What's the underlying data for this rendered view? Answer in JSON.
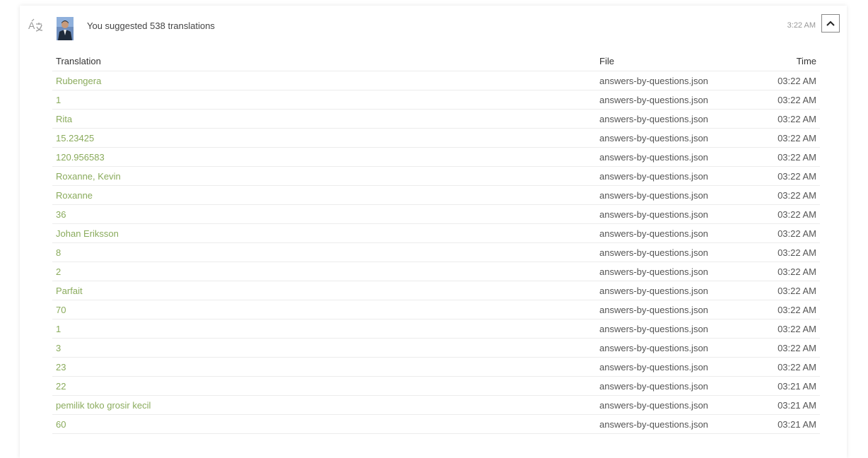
{
  "activity": {
    "icon": "translate-icon",
    "avatar": "user-avatar",
    "summary": "You suggested 538 translations",
    "timestamp": "3:22 AM",
    "collapse_icon": "chevron-up-icon"
  },
  "table": {
    "headers": {
      "translation": "Translation",
      "file": "File",
      "time": "Time"
    },
    "rows": [
      {
        "translation": "Rubengera",
        "file": "answers-by-questions.json",
        "time": "03:22 AM"
      },
      {
        "translation": "1",
        "file": "answers-by-questions.json",
        "time": "03:22 AM"
      },
      {
        "translation": "Rita",
        "file": "answers-by-questions.json",
        "time": "03:22 AM"
      },
      {
        "translation": "15.23425",
        "file": "answers-by-questions.json",
        "time": "03:22 AM"
      },
      {
        "translation": "120.956583",
        "file": "answers-by-questions.json",
        "time": "03:22 AM"
      },
      {
        "translation": "Roxanne, Kevin",
        "file": "answers-by-questions.json",
        "time": "03:22 AM"
      },
      {
        "translation": "Roxanne",
        "file": "answers-by-questions.json",
        "time": "03:22 AM"
      },
      {
        "translation": "36",
        "file": "answers-by-questions.json",
        "time": "03:22 AM"
      },
      {
        "translation": "Johan Eriksson",
        "file": "answers-by-questions.json",
        "time": "03:22 AM"
      },
      {
        "translation": "8",
        "file": "answers-by-questions.json",
        "time": "03:22 AM"
      },
      {
        "translation": "2",
        "file": "answers-by-questions.json",
        "time": "03:22 AM"
      },
      {
        "translation": "Parfait",
        "file": "answers-by-questions.json",
        "time": "03:22 AM"
      },
      {
        "translation": "70",
        "file": "answers-by-questions.json",
        "time": "03:22 AM"
      },
      {
        "translation": "1",
        "file": "answers-by-questions.json",
        "time": "03:22 AM"
      },
      {
        "translation": "3",
        "file": "answers-by-questions.json",
        "time": "03:22 AM"
      },
      {
        "translation": "23",
        "file": "answers-by-questions.json",
        "time": "03:22 AM"
      },
      {
        "translation": "22",
        "file": "answers-by-questions.json",
        "time": "03:21 AM"
      },
      {
        "translation": "pemilik toko grosir kecil",
        "file": "answers-by-questions.json",
        "time": "03:21 AM"
      },
      {
        "translation": "60",
        "file": "answers-by-questions.json",
        "time": "03:21 AM"
      }
    ]
  },
  "colors": {
    "link": "#8aab5c",
    "text": "#555555",
    "border": "#ececec",
    "muted": "#999999"
  }
}
